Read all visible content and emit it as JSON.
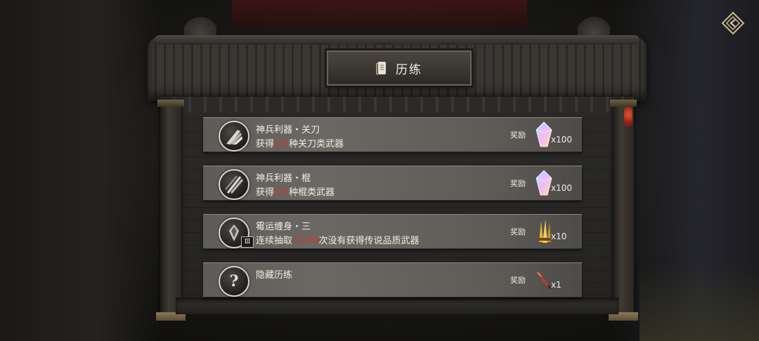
{
  "panel": {
    "title": "历练",
    "title_icon": "scroll-icon"
  },
  "tasks": [
    {
      "icon": "blade-weapon-icon",
      "title": "神兵利器・关刀",
      "desc_prefix": "获得",
      "progress": "2/3",
      "desc_suffix": "种关刀类武器",
      "reward_label": "奖励",
      "reward_icon": "crystal-icon",
      "reward_count": "x100"
    },
    {
      "icon": "staff-weapon-icon",
      "title": "神兵利器・棍",
      "desc_prefix": "获得",
      "progress": "2/3",
      "desc_suffix": "种棍类武器",
      "reward_label": "奖励",
      "reward_icon": "crystal-icon",
      "reward_count": "x100"
    },
    {
      "icon": "misfortune-icon",
      "roman": "Ⅲ",
      "title": "霉运缠身・三",
      "desc_prefix": "连续抽取",
      "progress": "11/99",
      "desc_suffix": "次没有获得传说品质武器",
      "reward_label": "奖励",
      "reward_icon": "golden-weapons-icon",
      "reward_count": "x10"
    },
    {
      "icon": "question-mark-icon",
      "icon_glyph": "?",
      "title": "隐藏历练",
      "reward_label": "奖励",
      "reward_icon": "red-blade-icon",
      "reward_count": "x1"
    }
  ],
  "colors": {
    "progress": "#d0372c",
    "row_bg": "#65625e",
    "text": "#f2eee6"
  }
}
